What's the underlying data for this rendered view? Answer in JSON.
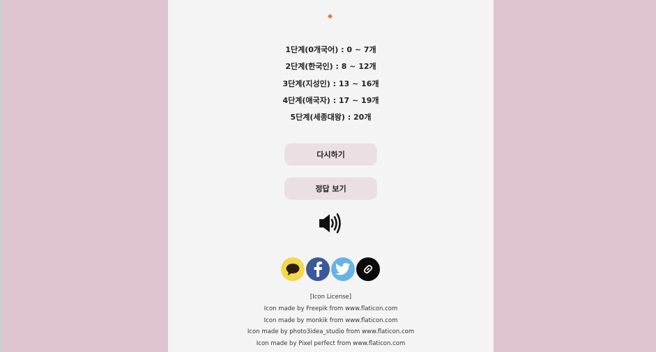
{
  "levels": [
    "1단계(0개국어) : 0 ~ 7개",
    "2단계(한국인) : 8 ~ 12개",
    "3단계(지성인) : 13 ~ 16개",
    "4단계(애국자) : 17 ~ 19개",
    "5단계(세종대왕) : 20개"
  ],
  "buttons": {
    "retry_label": "다시하기",
    "answer_label": "정답 보기"
  },
  "icons": {
    "sound": "speaker-icon",
    "share": [
      "kakaotalk-icon",
      "facebook-icon",
      "twitter-icon",
      "link-icon"
    ]
  },
  "colors": {
    "background": "#e0c3d1",
    "panel": "#f4f4f4",
    "button": "#eadfe3",
    "accent": "#e07a2e",
    "kakao": "#f2d94a",
    "facebook": "#3b5998",
    "twitter": "#66b3e6",
    "link": "#0a0a0a"
  },
  "license": {
    "title": "[Icon License]",
    "lines": [
      "Icon made by Freepik from www.flaticon.com",
      "Icon made by monkik from www.flaticon.com",
      "Icon made by photo3idea_studio from www.flaticon.com",
      "Icon made by Pixel perfect from www.flaticon.com"
    ]
  }
}
